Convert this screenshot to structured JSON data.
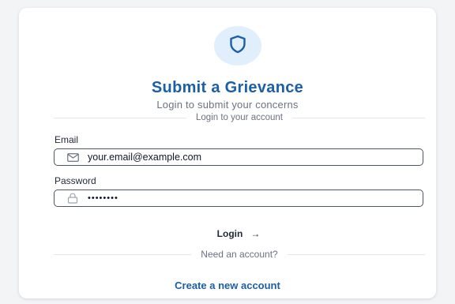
{
  "header": {
    "title": "Submit a Grievance",
    "subtitle": "Login to submit your concerns",
    "icon": "shield-icon"
  },
  "form": {
    "section_label": "Login to your account",
    "email_label": "Email",
    "email_value": "your.email@example.com",
    "password_label": "Password",
    "password_value": "••••••••",
    "login_label": "Login",
    "login_arrow": "→"
  },
  "footer": {
    "prompt": "Need an account?",
    "create_link": "Create a new account"
  },
  "colors": {
    "accent": "#1b5fa8",
    "icon_bg": "#e0effb"
  }
}
